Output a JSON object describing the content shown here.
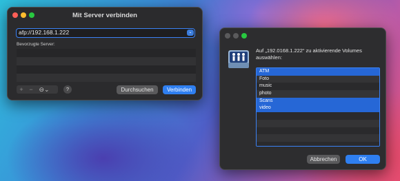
{
  "connect_window": {
    "title": "Mit Server verbinden",
    "address_value": "afp://192.168.1.222",
    "favorites_label": "Bevorzugte Server:",
    "favorites_rows": 4,
    "controls": {
      "add": "+",
      "remove": "−",
      "options": "⊖⌄"
    },
    "help_label": "?",
    "browse_label": "Durchsuchen",
    "connect_label": "Verbinden"
  },
  "volume_dialog": {
    "message": "Auf „192.0168.1.222“ zu aktivierende Volumes auswählen:",
    "volumes": [
      {
        "label": "ATM",
        "selected": true
      },
      {
        "label": "Foto",
        "selected": false
      },
      {
        "label": "music",
        "selected": false
      },
      {
        "label": "photo",
        "selected": false
      },
      {
        "label": "Scans",
        "selected": true
      },
      {
        "label": "video",
        "selected": true
      }
    ],
    "empty_rows": 5,
    "cancel_label": "Abbrechen",
    "ok_label": "OK"
  },
  "colors": {
    "accent": "#2f7ff0",
    "close": "#ff5f57",
    "minimize": "#febc2e",
    "zoom": "#28c840",
    "inactive": "#5a5a5c"
  }
}
